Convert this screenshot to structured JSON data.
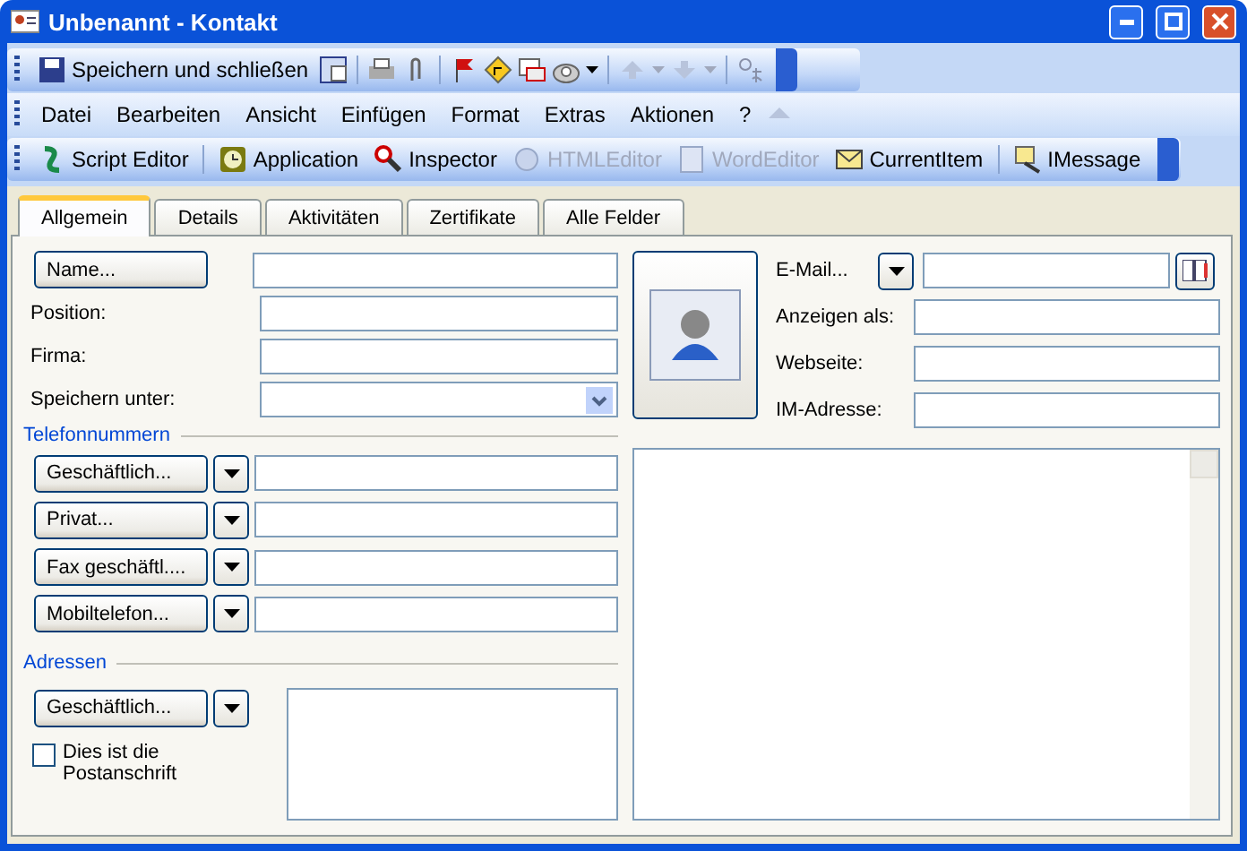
{
  "window": {
    "title": "Unbenannt - Kontakt"
  },
  "standard_toolbar": {
    "save_close_label": "Speichern und schließen"
  },
  "menu": [
    "Datei",
    "Bearbeiten",
    "Ansicht",
    "Einfügen",
    "Format",
    "Extras",
    "Aktionen",
    "?"
  ],
  "custom_toolbar": [
    {
      "label": "Script Editor",
      "disabled": false
    },
    {
      "label": "Application",
      "disabled": false
    },
    {
      "label": "Inspector",
      "disabled": false
    },
    {
      "label": "HTMLEditor",
      "disabled": true
    },
    {
      "label": "WordEditor",
      "disabled": true
    },
    {
      "label": "CurrentItem",
      "disabled": false
    },
    {
      "label": "IMessage",
      "disabled": false
    }
  ],
  "tabs": [
    {
      "label": "Allgemein",
      "selected": true
    },
    {
      "label": "Details",
      "selected": false
    },
    {
      "label": "Aktivitäten",
      "selected": false
    },
    {
      "label": "Zertifikate",
      "selected": false
    },
    {
      "label": "Alle Felder",
      "selected": false
    }
  ],
  "general": {
    "name_button": "Name...",
    "position_label": "Position:",
    "company_label": "Firma:",
    "file_as_label": "Speichern unter:",
    "phone_section": "Telefonnummern",
    "phones": [
      {
        "label": "Geschäftlich..."
      },
      {
        "label": "Privat..."
      },
      {
        "label": "Fax geschäftl...."
      },
      {
        "label": "Mobiltelefon..."
      }
    ],
    "address_section": "Adressen",
    "address_button": "Geschäftlich...",
    "mailing_address": {
      "label": "Dies ist die Postanschrift",
      "checked": false
    },
    "email_button": "E-Mail...",
    "display_as_label": "Anzeigen als:",
    "web_label": "Webseite:",
    "im_label": "IM-Adresse:"
  }
}
